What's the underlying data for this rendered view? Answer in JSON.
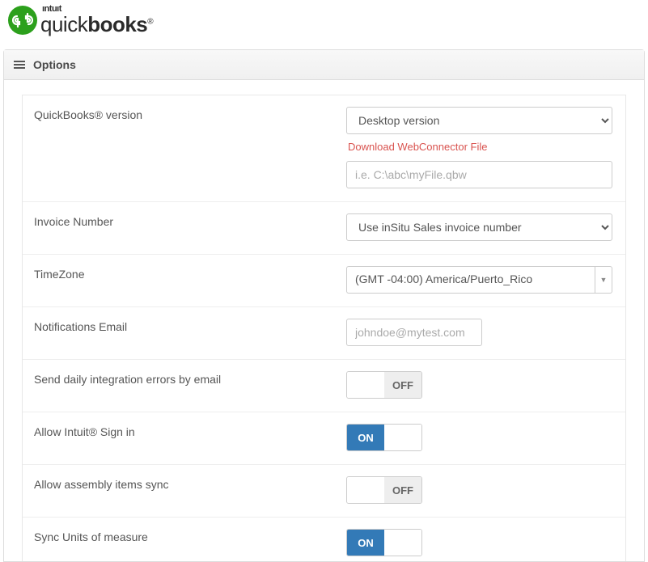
{
  "header": {
    "brand_top": "ıntuıt",
    "brand_bottom_light": "quick",
    "brand_bottom_bold": "books",
    "panel_title": "Options"
  },
  "fields": {
    "version_label": "QuickBooks® version",
    "version_value": "Desktop version",
    "download_link": "Download WebConnector File",
    "filepath_placeholder": "i.e. C:\\abc\\myFile.qbw",
    "invoice_label": "Invoice Number",
    "invoice_value": "Use inSitu Sales invoice number",
    "timezone_label": "TimeZone",
    "timezone_value": "(GMT -04:00) America/Puerto_Rico",
    "notif_label": "Notifications Email",
    "notif_placeholder": "johndoe@mytest.com",
    "daily_errors_label": "Send daily integration errors by email",
    "daily_errors_state": "OFF",
    "intuit_signin_label": "Allow Intuit® Sign in",
    "intuit_signin_state": "ON",
    "assembly_label": "Allow assembly items sync",
    "assembly_state": "OFF",
    "uom_label": "Sync Units of measure",
    "uom_state": "ON"
  }
}
